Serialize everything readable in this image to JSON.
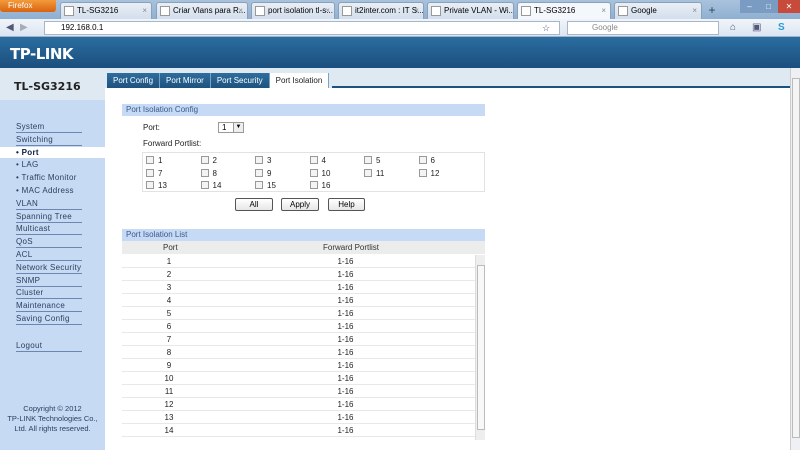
{
  "browser": {
    "menu_button": "Firefox",
    "tabs": [
      {
        "label": "TL-SG3216"
      },
      {
        "label": "Criar Vlans para R..."
      },
      {
        "label": "port isolation tl-s..."
      },
      {
        "label": "it2inter.com : IT S..."
      },
      {
        "label": "Private VLAN - Wi..."
      },
      {
        "label": "TL-SG3216",
        "active": true
      },
      {
        "label": "Google"
      }
    ],
    "url": "192.168.0.1",
    "search_placeholder": "Google"
  },
  "header": {
    "logo": "TP-LINK",
    "model": "TL-SG3216"
  },
  "sidebar": {
    "items": [
      {
        "label": "System"
      },
      {
        "label": "Switching"
      },
      {
        "label": "• Port",
        "sub": true,
        "selected": true
      },
      {
        "label": "• LAG",
        "sub": true
      },
      {
        "label": "• Traffic Monitor",
        "sub": true
      },
      {
        "label": "• MAC Address",
        "sub": true
      },
      {
        "label": "VLAN"
      },
      {
        "label": "Spanning Tree"
      },
      {
        "label": "Multicast"
      },
      {
        "label": "QoS"
      },
      {
        "label": "ACL"
      },
      {
        "label": "Network Security"
      },
      {
        "label": "SNMP"
      },
      {
        "label": "Cluster"
      },
      {
        "label": "Maintenance"
      },
      {
        "label": "Saving Config"
      },
      {
        "label": "Logout",
        "gap": true
      }
    ],
    "copyright": [
      "Copyright © 2012",
      "TP-LINK Technologies Co.,",
      "Ltd. All rights reserved."
    ]
  },
  "tabs": [
    {
      "label": "Port Config"
    },
    {
      "label": "Port Mirror"
    },
    {
      "label": "Port Security"
    },
    {
      "label": "Port Isolation",
      "active": true
    }
  ],
  "config": {
    "title": "Port Isolation Config",
    "port_label": "Port:",
    "port_value": "1",
    "portlist_label": "Forward Portlist:",
    "ports": [
      "1",
      "2",
      "3",
      "4",
      "5",
      "6",
      "7",
      "8",
      "9",
      "10",
      "11",
      "12",
      "13",
      "14",
      "15",
      "16"
    ],
    "buttons": {
      "all": "All",
      "apply": "Apply",
      "help": "Help"
    }
  },
  "list": {
    "title": "Port Isolation List",
    "columns": [
      "Port",
      "Forward Portlist"
    ],
    "rows": [
      [
        "1",
        "1-16"
      ],
      [
        "2",
        "1-16"
      ],
      [
        "3",
        "1-16"
      ],
      [
        "4",
        "1-16"
      ],
      [
        "5",
        "1-16"
      ],
      [
        "6",
        "1-16"
      ],
      [
        "7",
        "1-16"
      ],
      [
        "8",
        "1-16"
      ],
      [
        "9",
        "1-16"
      ],
      [
        "10",
        "1-16"
      ],
      [
        "11",
        "1-16"
      ],
      [
        "12",
        "1-16"
      ],
      [
        "13",
        "1-16"
      ],
      [
        "14",
        "1-16"
      ]
    ]
  }
}
